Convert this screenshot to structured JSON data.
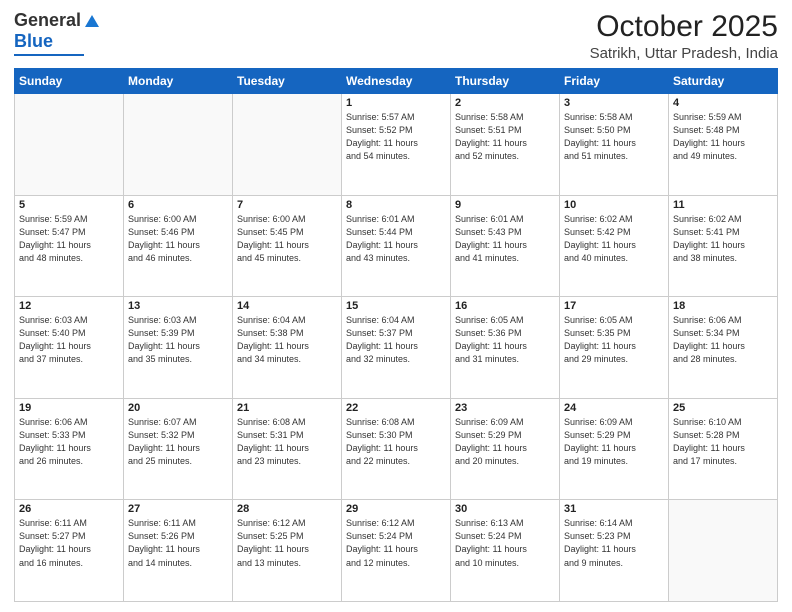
{
  "header": {
    "logo_general": "General",
    "logo_blue": "Blue",
    "month": "October 2025",
    "location": "Satrikh, Uttar Pradesh, India"
  },
  "days_of_week": [
    "Sunday",
    "Monday",
    "Tuesday",
    "Wednesday",
    "Thursday",
    "Friday",
    "Saturday"
  ],
  "weeks": [
    [
      {
        "day": "",
        "info": ""
      },
      {
        "day": "",
        "info": ""
      },
      {
        "day": "",
        "info": ""
      },
      {
        "day": "1",
        "info": "Sunrise: 5:57 AM\nSunset: 5:52 PM\nDaylight: 11 hours\nand 54 minutes."
      },
      {
        "day": "2",
        "info": "Sunrise: 5:58 AM\nSunset: 5:51 PM\nDaylight: 11 hours\nand 52 minutes."
      },
      {
        "day": "3",
        "info": "Sunrise: 5:58 AM\nSunset: 5:50 PM\nDaylight: 11 hours\nand 51 minutes."
      },
      {
        "day": "4",
        "info": "Sunrise: 5:59 AM\nSunset: 5:48 PM\nDaylight: 11 hours\nand 49 minutes."
      }
    ],
    [
      {
        "day": "5",
        "info": "Sunrise: 5:59 AM\nSunset: 5:47 PM\nDaylight: 11 hours\nand 48 minutes."
      },
      {
        "day": "6",
        "info": "Sunrise: 6:00 AM\nSunset: 5:46 PM\nDaylight: 11 hours\nand 46 minutes."
      },
      {
        "day": "7",
        "info": "Sunrise: 6:00 AM\nSunset: 5:45 PM\nDaylight: 11 hours\nand 45 minutes."
      },
      {
        "day": "8",
        "info": "Sunrise: 6:01 AM\nSunset: 5:44 PM\nDaylight: 11 hours\nand 43 minutes."
      },
      {
        "day": "9",
        "info": "Sunrise: 6:01 AM\nSunset: 5:43 PM\nDaylight: 11 hours\nand 41 minutes."
      },
      {
        "day": "10",
        "info": "Sunrise: 6:02 AM\nSunset: 5:42 PM\nDaylight: 11 hours\nand 40 minutes."
      },
      {
        "day": "11",
        "info": "Sunrise: 6:02 AM\nSunset: 5:41 PM\nDaylight: 11 hours\nand 38 minutes."
      }
    ],
    [
      {
        "day": "12",
        "info": "Sunrise: 6:03 AM\nSunset: 5:40 PM\nDaylight: 11 hours\nand 37 minutes."
      },
      {
        "day": "13",
        "info": "Sunrise: 6:03 AM\nSunset: 5:39 PM\nDaylight: 11 hours\nand 35 minutes."
      },
      {
        "day": "14",
        "info": "Sunrise: 6:04 AM\nSunset: 5:38 PM\nDaylight: 11 hours\nand 34 minutes."
      },
      {
        "day": "15",
        "info": "Sunrise: 6:04 AM\nSunset: 5:37 PM\nDaylight: 11 hours\nand 32 minutes."
      },
      {
        "day": "16",
        "info": "Sunrise: 6:05 AM\nSunset: 5:36 PM\nDaylight: 11 hours\nand 31 minutes."
      },
      {
        "day": "17",
        "info": "Sunrise: 6:05 AM\nSunset: 5:35 PM\nDaylight: 11 hours\nand 29 minutes."
      },
      {
        "day": "18",
        "info": "Sunrise: 6:06 AM\nSunset: 5:34 PM\nDaylight: 11 hours\nand 28 minutes."
      }
    ],
    [
      {
        "day": "19",
        "info": "Sunrise: 6:06 AM\nSunset: 5:33 PM\nDaylight: 11 hours\nand 26 minutes."
      },
      {
        "day": "20",
        "info": "Sunrise: 6:07 AM\nSunset: 5:32 PM\nDaylight: 11 hours\nand 25 minutes."
      },
      {
        "day": "21",
        "info": "Sunrise: 6:08 AM\nSunset: 5:31 PM\nDaylight: 11 hours\nand 23 minutes."
      },
      {
        "day": "22",
        "info": "Sunrise: 6:08 AM\nSunset: 5:30 PM\nDaylight: 11 hours\nand 22 minutes."
      },
      {
        "day": "23",
        "info": "Sunrise: 6:09 AM\nSunset: 5:29 PM\nDaylight: 11 hours\nand 20 minutes."
      },
      {
        "day": "24",
        "info": "Sunrise: 6:09 AM\nSunset: 5:29 PM\nDaylight: 11 hours\nand 19 minutes."
      },
      {
        "day": "25",
        "info": "Sunrise: 6:10 AM\nSunset: 5:28 PM\nDaylight: 11 hours\nand 17 minutes."
      }
    ],
    [
      {
        "day": "26",
        "info": "Sunrise: 6:11 AM\nSunset: 5:27 PM\nDaylight: 11 hours\nand 16 minutes."
      },
      {
        "day": "27",
        "info": "Sunrise: 6:11 AM\nSunset: 5:26 PM\nDaylight: 11 hours\nand 14 minutes."
      },
      {
        "day": "28",
        "info": "Sunrise: 6:12 AM\nSunset: 5:25 PM\nDaylight: 11 hours\nand 13 minutes."
      },
      {
        "day": "29",
        "info": "Sunrise: 6:12 AM\nSunset: 5:24 PM\nDaylight: 11 hours\nand 12 minutes."
      },
      {
        "day": "30",
        "info": "Sunrise: 6:13 AM\nSunset: 5:24 PM\nDaylight: 11 hours\nand 10 minutes."
      },
      {
        "day": "31",
        "info": "Sunrise: 6:14 AM\nSunset: 5:23 PM\nDaylight: 11 hours\nand 9 minutes."
      },
      {
        "day": "",
        "info": ""
      }
    ]
  ]
}
